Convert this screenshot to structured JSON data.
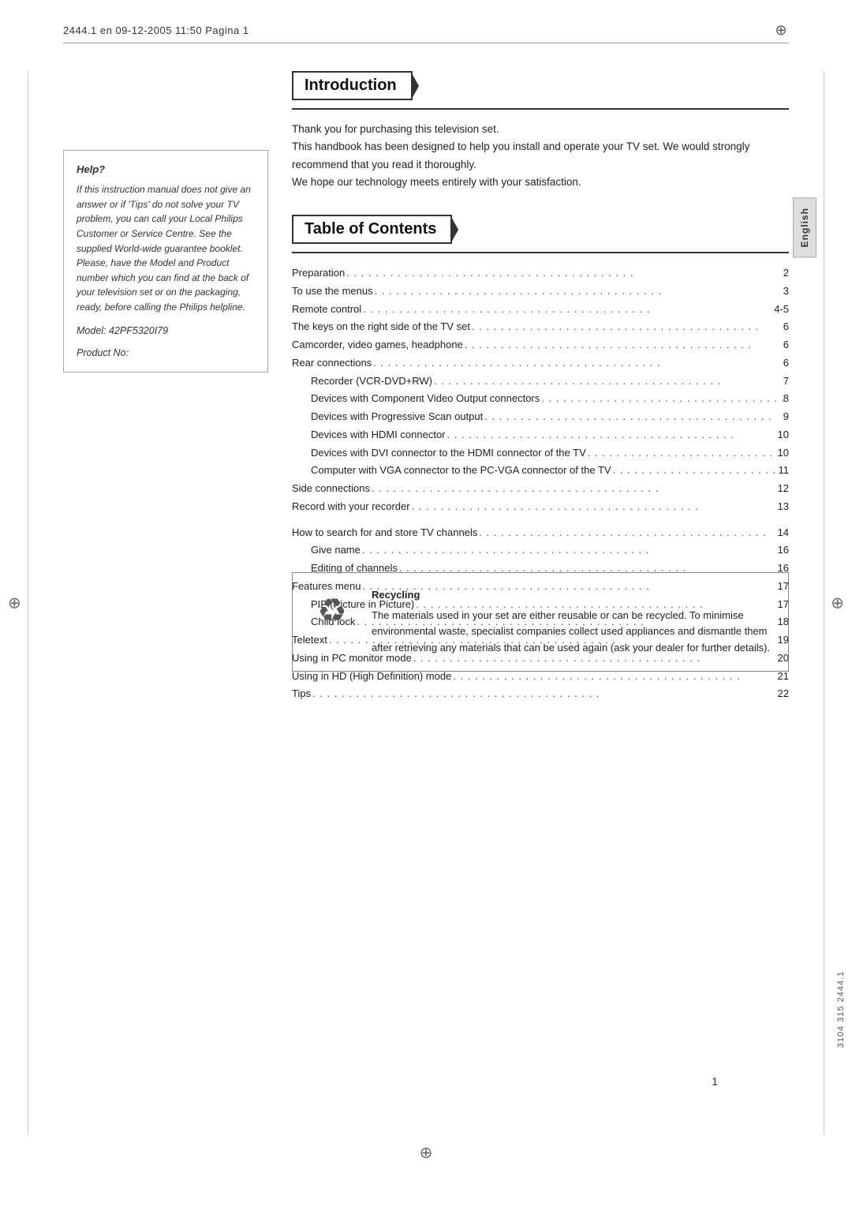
{
  "header": {
    "text": "2444.1 en  09-12-2005  11:50  Pagina 1"
  },
  "help_box": {
    "title": "Help?",
    "body": "If this instruction manual does not give an answer or if 'Tips' do not solve your TV problem, you can call your Local Philips Customer or Service Centre. See the supplied World-wide guarantee booklet. Please, have the Model and Product number which you can find at the back of your television set or on the packaging, ready, before calling the Philips helpline.",
    "model_label": "Model:",
    "model_value": "42PF5320I79",
    "product_label": "Product No:"
  },
  "introduction": {
    "heading": "Introduction",
    "paragraph1": "Thank you for purchasing this television set.",
    "paragraph2": "This handbook has been designed to help you install and operate your TV set.  We would strongly recommend that you read it thoroughly.",
    "paragraph3": "We hope our technology meets entirely with your satisfaction."
  },
  "toc": {
    "heading": "Table of Contents",
    "entries": [
      {
        "label": "Preparation",
        "dots": true,
        "page": "2",
        "indent": 0
      },
      {
        "label": "To use the menus",
        "dots": true,
        "page": "3",
        "indent": 0
      },
      {
        "label": "Remote control",
        "dots": true,
        "page": "4-5",
        "indent": 0
      },
      {
        "label": "The keys on the right side of the TV set",
        "dots": true,
        "page": "6",
        "indent": 0
      },
      {
        "label": "Camcorder, video games, headphone",
        "dots": true,
        "page": "6",
        "indent": 0
      },
      {
        "label": "Rear connections",
        "dots": true,
        "page": "6",
        "indent": 0
      },
      {
        "label": "Recorder (VCR-DVD+RW)",
        "dots": true,
        "page": "7",
        "indent": 1
      },
      {
        "label": "Devices with Component Video Output connectors",
        "dots": true,
        "page": "8",
        "indent": 1
      },
      {
        "label": "Devices with Progressive Scan output",
        "dots": true,
        "page": "9",
        "indent": 1
      },
      {
        "label": "Devices with HDMI connector",
        "dots": true,
        "page": "10",
        "indent": 1
      },
      {
        "label": "Devices with DVI connector to the HDMI connector of the TV",
        "dots": true,
        "page": "10",
        "indent": 1,
        "multiline": true
      },
      {
        "label": "Computer with VGA connector to the PC-VGA connector of the TV",
        "dots": true,
        "page": "11",
        "indent": 1,
        "multiline": true
      },
      {
        "label": "Side connections",
        "dots": true,
        "page": "12",
        "indent": 0
      },
      {
        "label": "Record with your recorder",
        "dots": true,
        "page": "13",
        "indent": 0
      },
      {
        "spacer": true
      },
      {
        "label": "How to search for and store TV channels",
        "dots": true,
        "page": "14",
        "indent": 0
      },
      {
        "label": "Give name",
        "dots": true,
        "page": "16",
        "indent": 1
      },
      {
        "label": "Editing of channels",
        "dots": true,
        "page": "16",
        "indent": 1
      },
      {
        "label": "Features menu",
        "dots": true,
        "page": "17",
        "indent": 0
      },
      {
        "label": "PIP (Picture in Picture)",
        "dots": true,
        "page": "17",
        "indent": 1
      },
      {
        "label": "Child lock",
        "dots": true,
        "page": "18",
        "indent": 1
      },
      {
        "label": "Teletext",
        "dots": true,
        "page": "19",
        "indent": 0
      },
      {
        "label": "Using in PC monitor mode",
        "dots": true,
        "page": "20",
        "indent": 0
      },
      {
        "label": "Using in HD (High Definition) mode",
        "dots": true,
        "page": "21",
        "indent": 0
      },
      {
        "label": "Tips",
        "dots": true,
        "page": "22",
        "indent": 0
      }
    ]
  },
  "recycling": {
    "title": "Recycling",
    "body": "The materials used in your set are either reusable or can be recycled. To minimise environmental waste, specialist companies collect used appliances and dismantle them after retrieving any materials that can be used again (ask your dealer for further details)."
  },
  "page_number": "1",
  "right_edge_text": "3104 315 2444.1",
  "english_tab": "English"
}
